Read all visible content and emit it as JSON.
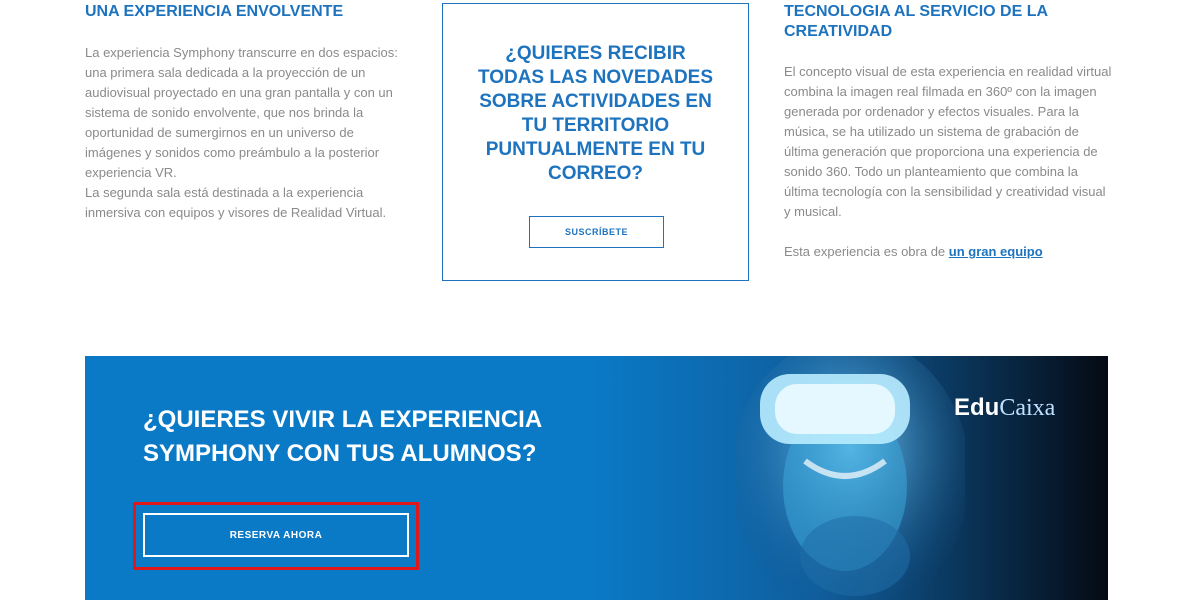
{
  "left": {
    "heading": "UNA EXPERIENCIA ENVOLVENTE",
    "paragraph1": "La experiencia Symphony transcurre en dos espacios: una primera sala dedicada a la proyección de un audiovisual proyectado en una gran pantalla y con un sistema de sonido envolvente, que nos brinda la oportunidad de sumergirnos en un universo de imágenes y sonidos como preámbulo a la posterior experiencia VR.",
    "paragraph2": "La segunda sala está destinada a la experiencia inmersiva con equipos y visores de Realidad Virtual."
  },
  "subscribe": {
    "title": "¿QUIERES RECIBIR TODAS LAS NOVEDADES SOBRE ACTIVIDADES EN TU TERRITORIO PUNTUALMENTE EN TU CORREO?",
    "button_label": "SUSCRÍBETE"
  },
  "right": {
    "heading": "TECNOLOGIA AL SERVICIO DE LA CREATIVIDAD",
    "paragraph": "El concepto visual de esta experiencia en realidad virtual combina la imagen real filmada en 360º con la imagen generada por ordenador y efectos visuales. Para la música, se ha utilizado un sistema de grabación de última generación que proporciona una experiencia de sonido 360. Todo un planteamiento que combina la última tecnología con la sensibilidad y creatividad visual y musical.",
    "credit_prefix": "Esta experiencia es obra de ",
    "credit_link": "un gran equipo"
  },
  "banner": {
    "title": "¿QUIERES VIVIR LA EXPERIENCIA SYMPHONY CON TUS ALUMNOS?",
    "button_label": "RESERVA AHORA",
    "logo_part1": "Edu",
    "logo_part2": "Caixa"
  }
}
